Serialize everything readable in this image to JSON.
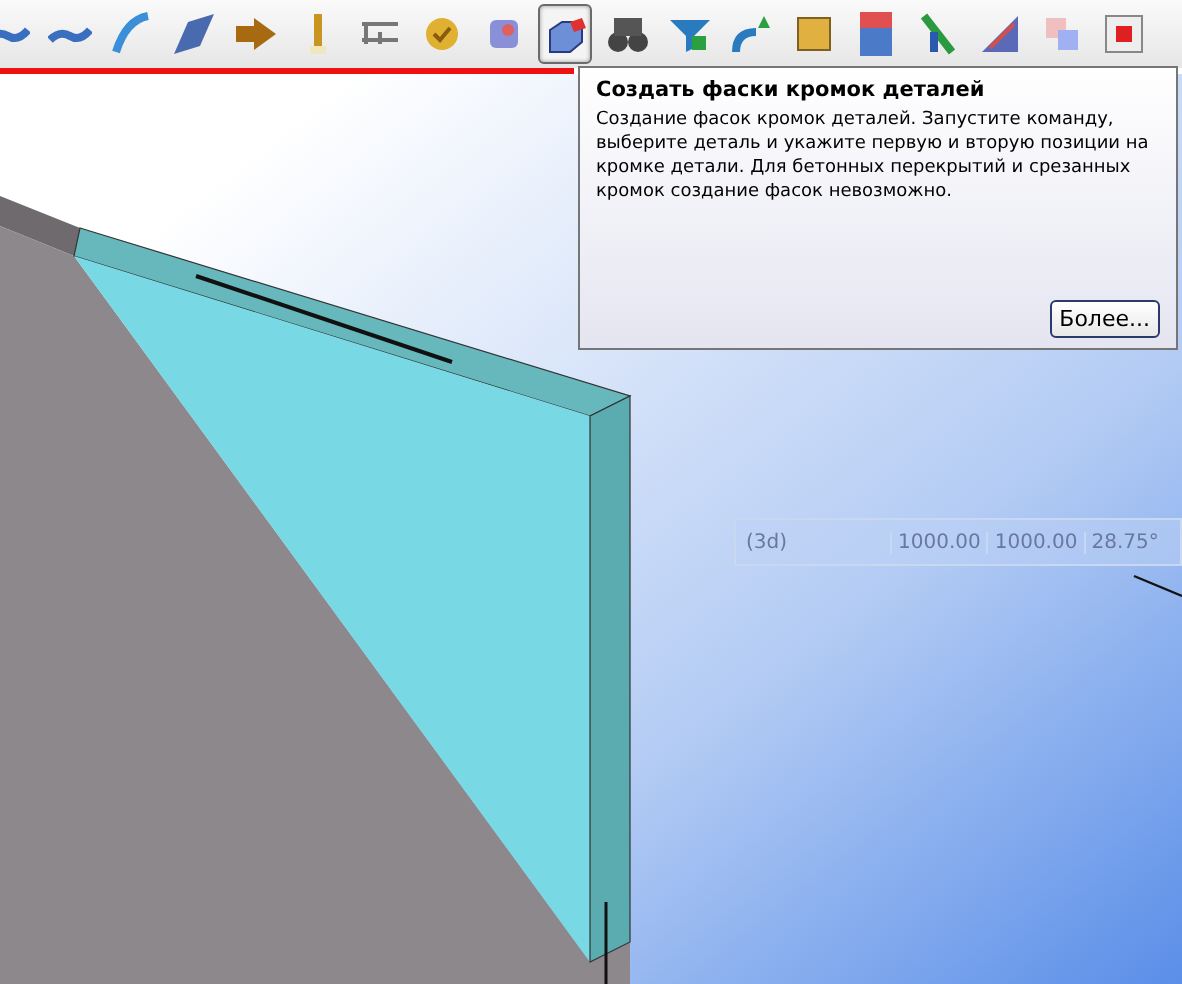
{
  "toolbar": {
    "buttons": [
      {
        "kind": "line",
        "selected": false
      },
      {
        "kind": "line",
        "selected": false
      },
      {
        "kind": "curve",
        "selected": false
      },
      {
        "kind": "plate",
        "selected": false
      },
      {
        "kind": "arrow",
        "selected": false
      },
      {
        "kind": "bolt",
        "selected": false
      },
      {
        "kind": "weld",
        "selected": false
      },
      {
        "kind": "ball",
        "selected": false
      },
      {
        "kind": "cube",
        "selected": false
      },
      {
        "kind": "chamfer",
        "selected": true
      },
      {
        "kind": "binoculars",
        "selected": false
      },
      {
        "kind": "filter",
        "selected": false
      },
      {
        "kind": "wave",
        "selected": false
      },
      {
        "kind": "square",
        "selected": false
      },
      {
        "kind": "pillar",
        "selected": false
      },
      {
        "kind": "beam",
        "selected": false
      },
      {
        "kind": "corner",
        "selected": false
      },
      {
        "kind": "copy",
        "selected": false
      },
      {
        "kind": "stop",
        "selected": false
      }
    ]
  },
  "tooltip": {
    "title": "Создать фаски кромок деталей",
    "text": "Создание фасок кромок деталей. Запустите команду, выберите деталь и укажите первую и вторую позиции на кромке детали. Для бетонных перекрытий и срезанных кромок создание фасок невозможно.",
    "button": "Более..."
  },
  "readout": {
    "mode": "(3d)",
    "values": [
      "1000.00",
      "1000.00",
      "28.75°"
    ]
  }
}
